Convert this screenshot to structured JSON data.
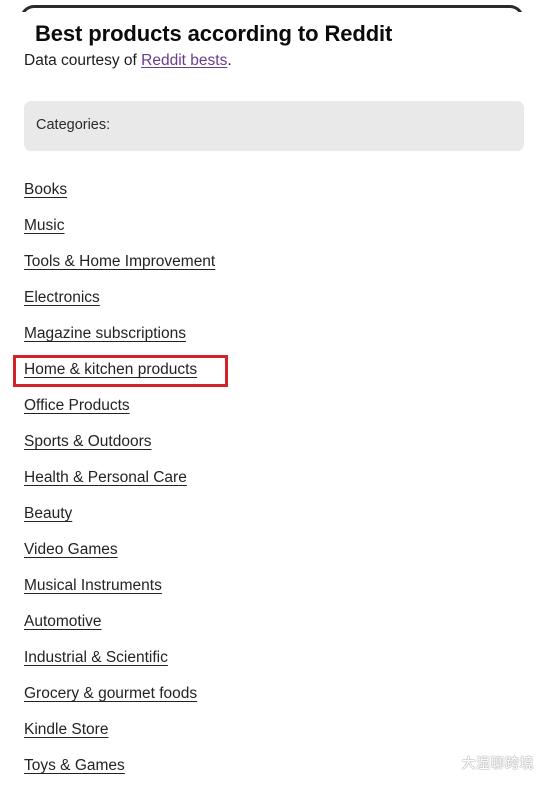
{
  "browser": {
    "frame_style": "rounded-dark-top-edge"
  },
  "header": {
    "title": "Best products according to Reddit",
    "subtitle_prefix": "Data courtesy of ",
    "subtitle_link": "Reddit bests",
    "subtitle_suffix": ".",
    "link_color": "#6a3a8c"
  },
  "categories_panel": {
    "label": "Categories:",
    "background": "#e9e9e9"
  },
  "category_list": [
    {
      "label": "Books",
      "highlighted": false
    },
    {
      "label": "Music",
      "highlighted": false
    },
    {
      "label": "Tools & Home Improvement",
      "highlighted": false
    },
    {
      "label": "Electronics",
      "highlighted": false
    },
    {
      "label": "Magazine subscriptions",
      "highlighted": false
    },
    {
      "label": "Home & kitchen products",
      "highlighted": true
    },
    {
      "label": "Office Products",
      "highlighted": false
    },
    {
      "label": "Sports & Outdoors",
      "highlighted": false
    },
    {
      "label": "Health & Personal Care",
      "highlighted": false
    },
    {
      "label": "Beauty",
      "highlighted": false
    },
    {
      "label": "Video Games",
      "highlighted": false
    },
    {
      "label": "Musical Instruments",
      "highlighted": false
    },
    {
      "label": "Automotive",
      "highlighted": false
    },
    {
      "label": "Industrial & Scientific",
      "highlighted": false
    },
    {
      "label": "Grocery & gourmet foods",
      "highlighted": false
    },
    {
      "label": "Kindle Store",
      "highlighted": false
    },
    {
      "label": "Toys & Games",
      "highlighted": false
    }
  ],
  "annotation": {
    "type": "red-rectangle",
    "target_label": "Home & kitchen products",
    "color": "#d2222a"
  },
  "watermark": {
    "icon": "wechat-icon",
    "text": "大湿聊跨境",
    "color": "#ffffff"
  }
}
